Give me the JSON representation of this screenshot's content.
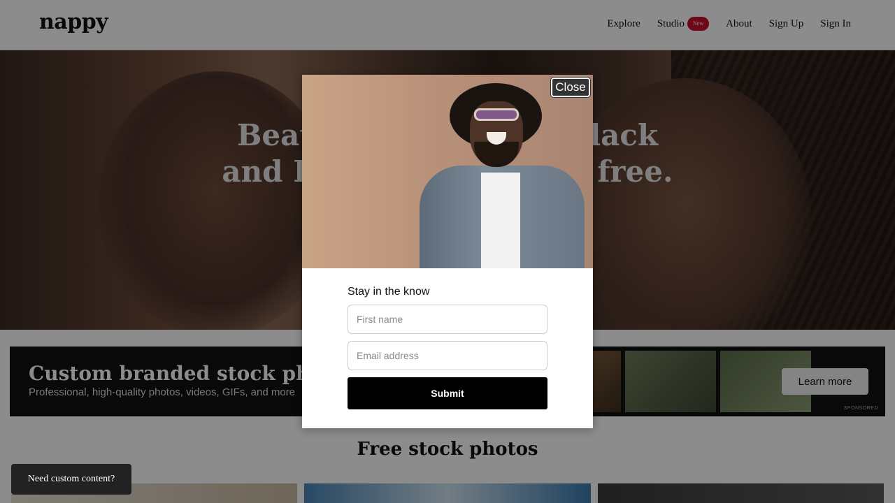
{
  "header": {
    "logo": "nappy",
    "nav": {
      "explore": "Explore",
      "studio": "Studio",
      "studio_badge": "New",
      "about": "About",
      "sign_up": "Sign Up",
      "sign_in": "Sign In"
    }
  },
  "hero": {
    "title_line1": "Beautiful photos of Black",
    "title_line2": "and Brown people, for free."
  },
  "banner": {
    "title": "Custom branded stock photos",
    "subtitle": "Professional, high-quality photos, videos, GIFs, and more",
    "button": "Learn more",
    "sponsored": "SPONSORED"
  },
  "section": {
    "title": "Free stock photos"
  },
  "cta": {
    "label": "Need custom content?"
  },
  "modal": {
    "close": "Close",
    "title": "Stay in the know",
    "first_name_placeholder": "First name",
    "email_placeholder": "Email address",
    "submit": "Submit"
  },
  "colors": {
    "badge": "#c8102e",
    "submit": "#000000",
    "overlay": "rgba(0,0,0,0.45)"
  }
}
